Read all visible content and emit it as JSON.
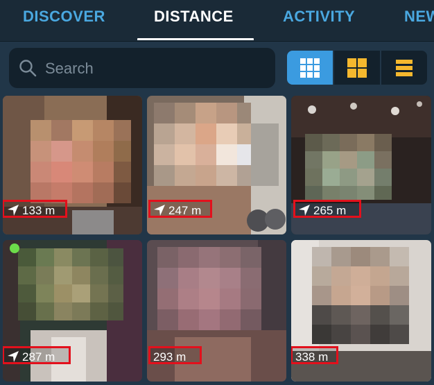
{
  "tabs": [
    {
      "label": "DISCOVER",
      "active": false
    },
    {
      "label": "DISTANCE",
      "active": true
    },
    {
      "label": "ACTIVITY",
      "active": false
    },
    {
      "label": "NEW",
      "active": false
    }
  ],
  "search": {
    "placeholder": "Search",
    "value": ""
  },
  "view_modes": [
    {
      "name": "grid-3x3",
      "selected": true
    },
    {
      "name": "grid-2x2",
      "selected": false
    },
    {
      "name": "list",
      "selected": false
    }
  ],
  "profiles": [
    {
      "distance": "133 m",
      "show_arrow": true,
      "online": false
    },
    {
      "distance": "247 m",
      "show_arrow": true,
      "online": false
    },
    {
      "distance": "265 m",
      "show_arrow": true,
      "online": false
    },
    {
      "distance": "287 m",
      "show_arrow": true,
      "online": true
    },
    {
      "distance": "293 m",
      "show_arrow": false,
      "online": false
    },
    {
      "distance": "338 m",
      "show_arrow": false,
      "online": false
    }
  ],
  "colors": {
    "accent": "#3b9be0",
    "tab_inactive": "#4aa8e0",
    "highlight_box": "#e3101c",
    "online": "#6ddc4a"
  }
}
